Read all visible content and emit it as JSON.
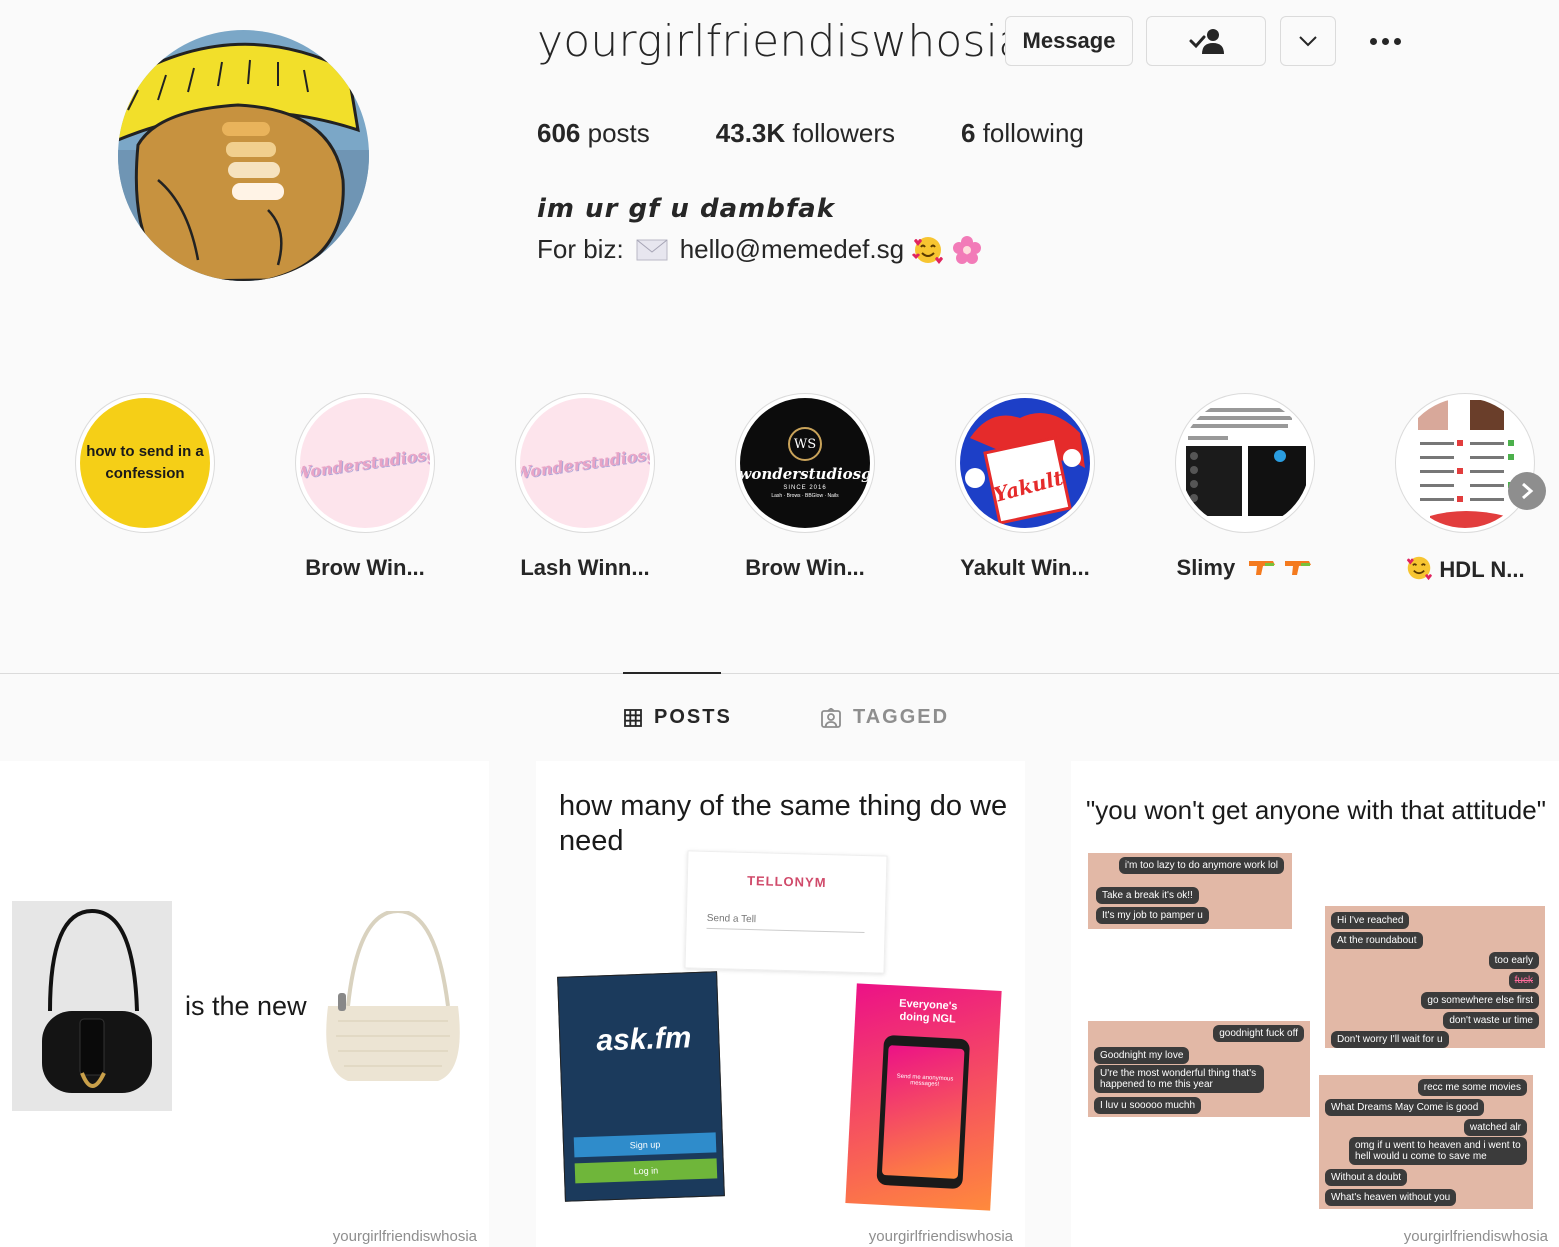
{
  "profile": {
    "username": "yourgirlfriendiswhosia",
    "message_label": "Message",
    "stats": {
      "posts_count": "606",
      "posts_label": "posts",
      "followers_count": "43.3K",
      "followers_label": "followers",
      "following_count": "6",
      "following_label": "following"
    },
    "bio_name": "im ur gf u dambfak",
    "bio_prefix": "For biz:",
    "bio_email": "hello@memedef.sg"
  },
  "highlights": [
    {
      "label": "",
      "cover_text": "how to send in a confession"
    },
    {
      "label": "Brow Win..."
    },
    {
      "label": "Lash Winn..."
    },
    {
      "label": "Brow Win..."
    },
    {
      "label": "Yakult Win..."
    },
    {
      "label": "Slimy"
    },
    {
      "label": "HDL N..."
    }
  ],
  "highlight_cover_text": {
    "wonder": "Wonderstudiosg",
    "ws_monogram": "WS",
    "ws_name": "wonderstudiosg",
    "ws_since": "SINCE 2016",
    "ws_services": "Lash · Brows · BBGlow · Nails",
    "yakult": "Yakult"
  },
  "tabs": {
    "posts": "POSTS",
    "tagged": "TAGGED"
  },
  "posts": [
    {
      "text": "is the new",
      "watermark": "yourgirlfriendiswhosia"
    },
    {
      "title": "how many of the same thing do we need",
      "tellonym": "TELLONYM",
      "tellonym_placeholder": "Send a Tell",
      "askfm": "ask.fm",
      "askfm_signup": "Sign up",
      "askfm_login": "Log in",
      "ngl": "Everyone's doing NGL",
      "ngl_sub": "Send me anonymous messages!",
      "watermark": "yourgirlfriendiswhosia"
    },
    {
      "title": "\"you won't get anyone with that attitude\"",
      "chat1": [
        "i'm too lazy to do anymore work lol",
        "Take a break it's ok!!",
        "It's my job to pamper u"
      ],
      "chat2": [
        "Hi I've reached",
        "At the roundabout",
        "too early",
        "fuck",
        "go somewhere else first",
        "don't waste ur time",
        "Don't worry I'll wait for u"
      ],
      "chat3": [
        "goodnight fuck off",
        "Goodnight my love",
        "U're the most wonderful thing that's happened to me this year",
        "I luv u sooooo muchh"
      ],
      "chat4": [
        "recc me some movies",
        "What Dreams May Come is good",
        "watched alr",
        "omg if u went to heaven and i went to hell would u come to save me",
        "Without a doubt",
        "What's heaven without you"
      ],
      "watermark": "yourgirlfriendiswhosia"
    }
  ],
  "colors": {
    "text": "#262626",
    "muted": "#8e8e8e",
    "border": "#dbdbdb",
    "background": "#fafafa"
  }
}
